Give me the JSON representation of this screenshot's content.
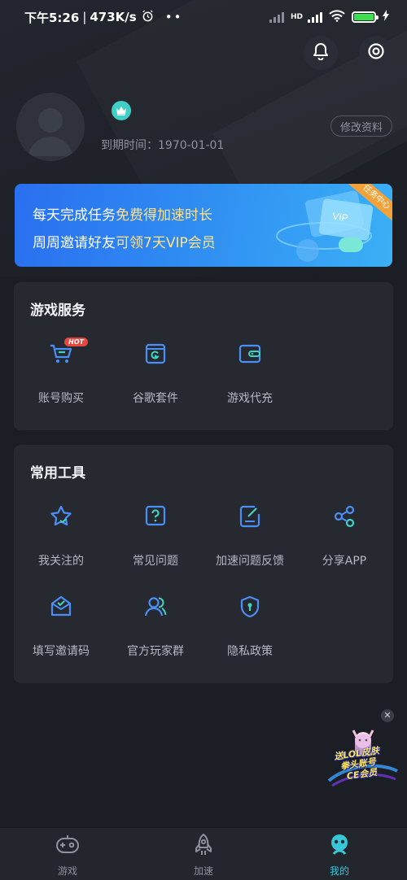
{
  "status_bar": {
    "time": "下午5:26",
    "network_speed": "473K/s",
    "network_type": "HD"
  },
  "header": {
    "notification_icon": "bell-icon",
    "settings_icon": "target-icon"
  },
  "profile": {
    "avatar_icon": "default-avatar",
    "badge_icon": "crown-icon",
    "expire_text": "到期时间：1970-01-01",
    "edit_label": "修改资料"
  },
  "banner": {
    "line1_prefix": "每天完成任务",
    "line1_highlight": "免费得加速时长",
    "line2_prefix": "周周邀请好友",
    "line2_highlight": "可领7天VIP会员",
    "tag": "任务中心",
    "illustration_text": "VIP"
  },
  "game_services": {
    "title": "游戏服务",
    "items": [
      {
        "label": "账号购买",
        "icon": "cart-icon",
        "badge": "HOT"
      },
      {
        "label": "谷歌套件",
        "icon": "google-suite-icon"
      },
      {
        "label": "游戏代充",
        "icon": "wallet-icon"
      }
    ]
  },
  "tools": {
    "title": "常用工具",
    "items": [
      {
        "label": "我关注的",
        "icon": "star-icon"
      },
      {
        "label": "常见问题",
        "icon": "question-icon"
      },
      {
        "label": "加速问题反馈",
        "icon": "feedback-icon"
      },
      {
        "label": "分享APP",
        "icon": "share-icon"
      },
      {
        "label": "填写邀请码",
        "icon": "invite-mail-icon"
      },
      {
        "label": "官方玩家群",
        "icon": "group-icon"
      },
      {
        "label": "隐私政策",
        "icon": "privacy-shield-icon"
      }
    ]
  },
  "promo": {
    "lines": [
      "送LOL皮肤",
      "拳头账号",
      "CE会员"
    ]
  },
  "bottom_nav": {
    "items": [
      {
        "label": "游戏",
        "icon": "gamepad-icon",
        "active": false
      },
      {
        "label": "加速",
        "icon": "rocket-icon",
        "active": false
      },
      {
        "label": "我的",
        "icon": "profile-icon",
        "active": true
      }
    ]
  }
}
